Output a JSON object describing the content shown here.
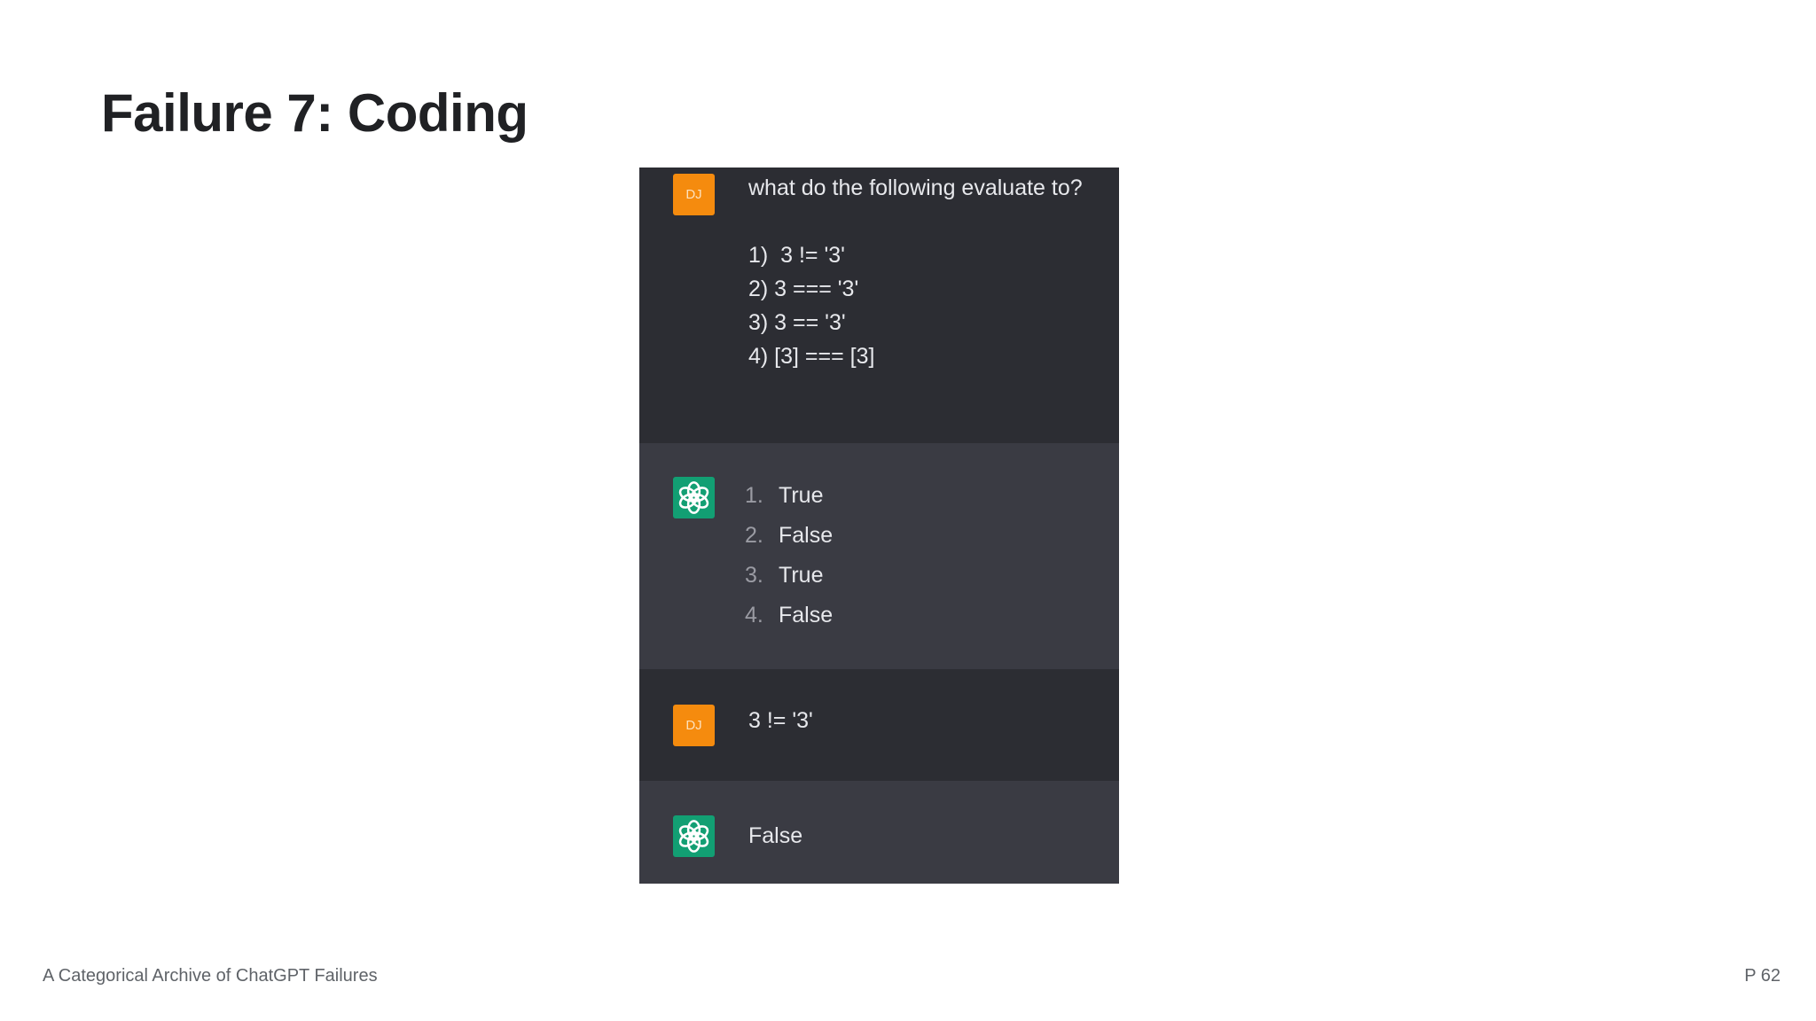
{
  "slide": {
    "title": "Failure 7: Coding",
    "footer_left": "A Categorical Archive of ChatGPT Failures",
    "page_number": "P 62"
  },
  "chat": {
    "user_avatar_initials": "DJ",
    "bot_avatar_icon": "openai-logo-icon",
    "colors": {
      "user_bg": "#2c2d33",
      "bot_bg": "#3a3b43",
      "user_avatar": "#f58b0e",
      "bot_avatar": "#129f73"
    },
    "messages": [
      {
        "role": "user",
        "intro": "what do the following evaluate to?",
        "lines": [
          "1)  3 != '3'",
          "2) 3 === '3'",
          "3) 3 == '3'",
          "4) [3] === [3]"
        ]
      },
      {
        "role": "assistant",
        "items": [
          {
            "num": "1.",
            "text": "True"
          },
          {
            "num": "2.",
            "text": "False"
          },
          {
            "num": "3.",
            "text": "True"
          },
          {
            "num": "4.",
            "text": "False"
          }
        ]
      },
      {
        "role": "user",
        "text": "3 != '3'"
      },
      {
        "role": "assistant",
        "text": "False"
      }
    ]
  }
}
